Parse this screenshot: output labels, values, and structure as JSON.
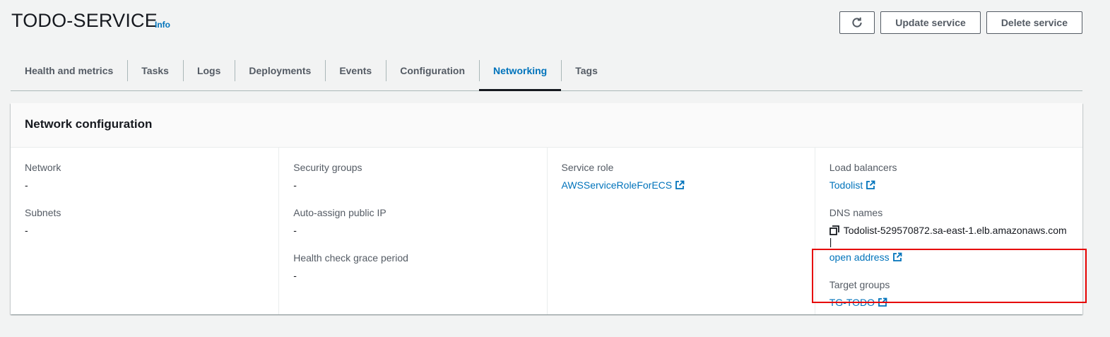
{
  "header": {
    "title": "TODO-SERVICE",
    "info_label": "Info",
    "actions": {
      "refresh_icon": "refresh-icon",
      "update_label": "Update service",
      "delete_label": "Delete service"
    }
  },
  "tabs": [
    {
      "label": "Health and metrics",
      "active": false
    },
    {
      "label": "Tasks",
      "active": false
    },
    {
      "label": "Logs",
      "active": false
    },
    {
      "label": "Deployments",
      "active": false
    },
    {
      "label": "Events",
      "active": false
    },
    {
      "label": "Configuration",
      "active": false
    },
    {
      "label": "Networking",
      "active": true
    },
    {
      "label": "Tags",
      "active": false
    }
  ],
  "panel": {
    "title": "Network configuration",
    "col1": {
      "network": {
        "label": "Network",
        "value": "-"
      },
      "subnets": {
        "label": "Subnets",
        "value": "-"
      }
    },
    "col2": {
      "security_groups": {
        "label": "Security groups",
        "value": "-"
      },
      "auto_assign_ip": {
        "label": "Auto-assign public IP",
        "value": "-"
      },
      "health_check": {
        "label": "Health check grace period",
        "value": "-"
      }
    },
    "col3": {
      "service_role": {
        "label": "Service role",
        "value": "AWSServiceRoleForECS"
      }
    },
    "col4": {
      "load_balancers": {
        "label": "Load balancers",
        "value": "Todolist"
      },
      "dns_names": {
        "label": "DNS names",
        "value": "Todolist-529570872.sa-east-1.elb.amazonaws.com |",
        "open_address": "open address"
      },
      "target_groups": {
        "label": "Target groups",
        "value": "TG-TODO"
      }
    }
  },
  "colors": {
    "link": "#0073bb",
    "highlight_box": "#e60000",
    "background": "#f2f3f3"
  }
}
